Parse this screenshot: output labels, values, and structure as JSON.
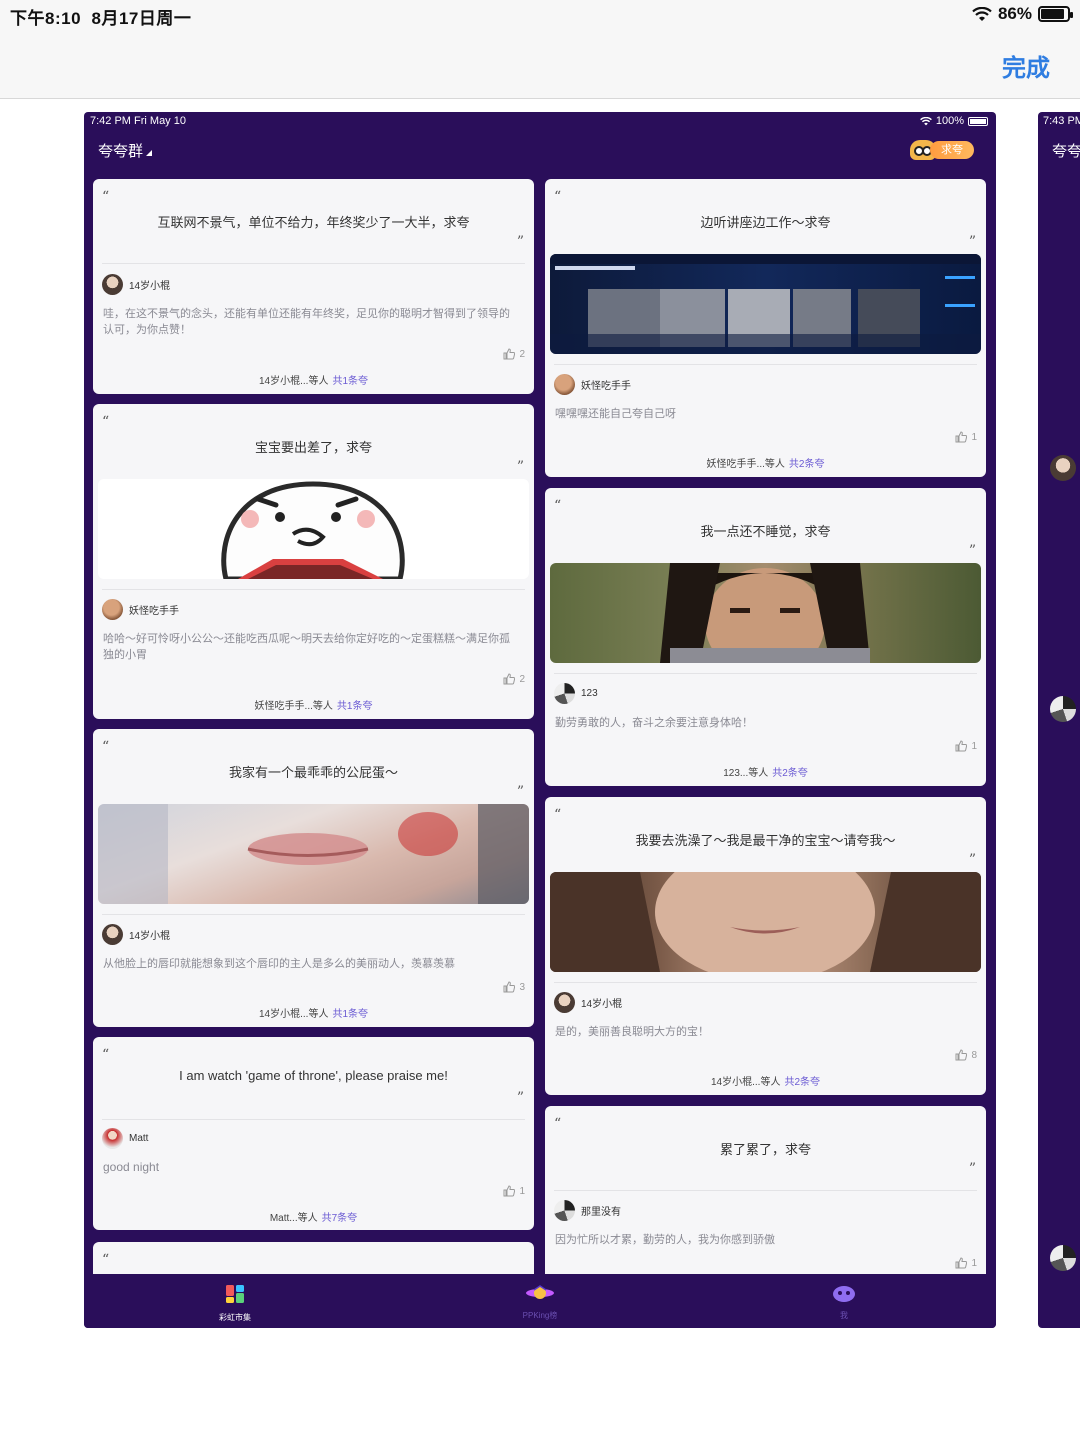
{
  "outer_status": {
    "time": "下午8:10",
    "date": "8月17日周一",
    "battery": "86%",
    "battery_level": 0.86
  },
  "outer_nav": {
    "done_label": "完成"
  },
  "phone": {
    "status": {
      "time": "7:42 PM  Fri May 10",
      "battery": "100%"
    },
    "title": "夸夸群",
    "ask_button": "求夸",
    "left_cards": [
      {
        "title": "互联网不景气，单位不给力，年终奖少了一大半，求夸",
        "user": "14岁小棍",
        "comment": "哇，在这不景气的念头，还能有单位还能有年终奖，足见你的聪明才智得到了领导的认可，为你点赞！",
        "likes": "2",
        "footer_names": "14岁小棍...等人",
        "footer_count": "共1条夸"
      },
      {
        "title": "宝宝要出差了，求夸",
        "user": "妖怪吃手手",
        "comment": "哈哈～好可怜呀小公公～还能吃西瓜呢～明天去给你定好吃的～定蛋糕糕～满足你孤独的小胃",
        "likes": "2",
        "footer_names": "妖怪吃手手...等人",
        "footer_count": "共1条夸"
      },
      {
        "title": "我家有一个最乖乖的公屁蛋～",
        "user": "14岁小棍",
        "comment": "从他脸上的唇印就能想象到这个唇印的主人是多么的美丽动人，羡慕羡慕",
        "likes": "3",
        "footer_names": "14岁小棍...等人",
        "footer_count": "共1条夸"
      },
      {
        "title": "I am watch 'game of throne', please praise me!",
        "user": "Matt",
        "comment": "good night",
        "likes": "1",
        "footer_names": "Matt...等人",
        "footer_count": "共7条夸"
      }
    ],
    "right_cards": [
      {
        "title": "边听讲座边工作～求夸",
        "user": "妖怪吃手手",
        "comment": "嘿嘿嘿还能自己夸自己呀",
        "likes": "1",
        "footer_names": "妖怪吃手手...等人",
        "footer_count": "共2条夸"
      },
      {
        "title": "我一点还不睡觉，求夸",
        "user": "123",
        "comment": "勤劳勇敢的人，奋斗之余要注意身体哈！",
        "likes": "1",
        "footer_names": "123...等人",
        "footer_count": "共2条夸"
      },
      {
        "title": "我要去洗澡了～我是最干净的宝宝～请夸我～",
        "user": "14岁小棍",
        "comment": "是的，美丽善良聪明大方的宝！",
        "likes": "8",
        "footer_names": "14岁小棍...等人",
        "footer_count": "共2条夸"
      },
      {
        "title": "累了累了，求夸",
        "user": "那里没有",
        "comment": "因为忙所以才累，勤劳的人，我为你感到骄傲",
        "likes": "1"
      }
    ],
    "tabs": [
      {
        "label": "彩虹市集"
      },
      {
        "label": "PPKing榜"
      },
      {
        "label": "我"
      }
    ]
  },
  "phone2": {
    "time": "7:43 PM",
    "title": "夸夸"
  }
}
